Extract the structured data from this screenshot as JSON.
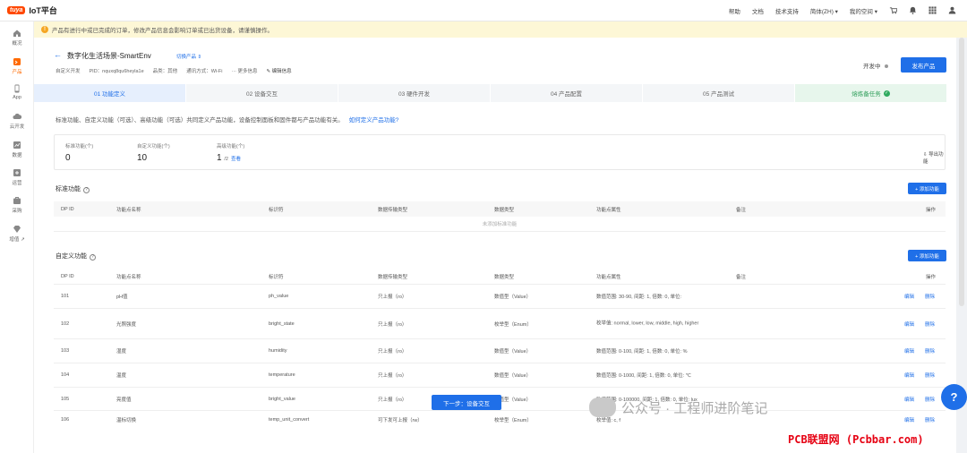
{
  "topbar": {
    "logo_mark": "tuya",
    "logo_text": "IoT平台",
    "nav": [
      "帮助",
      "文档",
      "技术支持",
      "简体(ZH) ▾",
      "我的空间 ▾"
    ]
  },
  "notice": {
    "text": "产品有进行中或已完成的订单，修改产品信息会影响订单或已出货设备，请谨慎操作。"
  },
  "sidebar": {
    "items": [
      {
        "label": "概况"
      },
      {
        "label": "产品"
      },
      {
        "label": "App"
      },
      {
        "label": "云开发"
      },
      {
        "label": "数据"
      },
      {
        "label": "运营"
      },
      {
        "label": "采购"
      },
      {
        "label": "增值 ↗"
      }
    ]
  },
  "product": {
    "title": "数字化生活场景-SmartEnv",
    "switch_label": "切换产品 ⇕",
    "meta": [
      "自定义开发",
      "PID：nquxq8qu6heyla1e",
      "品类：其他",
      "通讯方式：Wi-Fi",
      "··· 更多信息",
      "✎ 编辑信息"
    ],
    "status": "开发中",
    "publish_label": "发布产品"
  },
  "steps": [
    {
      "label": "01 功能定义"
    },
    {
      "label": "02 设备交互"
    },
    {
      "label": "03 硬件开发"
    },
    {
      "label": "04 产品配置"
    },
    {
      "label": "05 产品测试"
    },
    {
      "label": "熔炼备任务"
    }
  ],
  "intro": {
    "text": "标准功能、自定义功能（可选）、高级功能（可选）共同定义产品功能，设备控制面板和固件都与产品功能有关。",
    "link": "如何定义产品功能?"
  },
  "stats": {
    "standard_label": "标准功能(个)",
    "standard_value": "0",
    "custom_label": "自定义功能(个)",
    "custom_value": "10",
    "advanced_label": "高级功能(个)",
    "advanced_value": "1",
    "advanced_total": "/2",
    "advanced_view": "查看",
    "export_label": "导出功能"
  },
  "standard": {
    "title": "标准功能",
    "add_label": "+ 添加功能",
    "headers": [
      "DP ID",
      "功能点名称",
      "标识符",
      "数据传输类型",
      "数据类型",
      "功能点属性",
      "备注",
      "操作"
    ],
    "empty": "未添加标准功能"
  },
  "custom": {
    "title": "自定义功能",
    "add_label": "+ 添加功能",
    "headers": [
      "DP ID",
      "功能点名称",
      "标识符",
      "数据传输类型",
      "数据类型",
      "功能点属性",
      "备注",
      "操作"
    ],
    "rows": [
      {
        "id": "101",
        "name": "pH值",
        "code": "ph_value",
        "trans": "只上报（ro）",
        "type": "数值型（Value）",
        "attr": "数值范围: 30-90, 间距: 1, 倍数: 0, 单位:",
        "edit": "编辑",
        "del": "删除"
      },
      {
        "id": "102",
        "name": "光照强度",
        "code": "bright_state",
        "trans": "只上报（ro）",
        "type": "枚举型（Enum）",
        "attr": "枚举值: normal, lower, low, middle, high, higher",
        "edit": "编辑",
        "del": "删除"
      },
      {
        "id": "103",
        "name": "湿度",
        "code": "humidity",
        "trans": "只上报（ro）",
        "type": "数值型（Value）",
        "attr": "数值范围: 0-100, 间距: 1, 倍数: 0, 单位: %",
        "edit": "编辑",
        "del": "删除"
      },
      {
        "id": "104",
        "name": "温度",
        "code": "temperature",
        "trans": "只上报（ro）",
        "type": "数值型（Value）",
        "attr": "数值范围: 0-1000, 间距: 1, 倍数: 0, 单位: ℃",
        "edit": "编辑",
        "del": "删除"
      },
      {
        "id": "105",
        "name": "亮度值",
        "code": "bright_value",
        "trans": "只上报（ro）",
        "type": "数值型（Value）",
        "attr": "数值范围: 0-100000, 间距: 1, 倍数: 0, 单位: lux",
        "edit": "编辑",
        "del": "删除"
      },
      {
        "id": "106",
        "name": "温标切换",
        "code": "temp_unit_convert",
        "trans": "可下发可上报（rw）",
        "type": "枚举型（Enum）",
        "attr": "枚举值: c, f",
        "edit": "编辑",
        "del": "删除"
      }
    ]
  },
  "next_label": "下一步：设备交互",
  "help_glyph": "?",
  "watermark": "公众号 · 工程师进阶笔记",
  "footer_watermark": "PCB联盟网 (Pcbbar.com)"
}
